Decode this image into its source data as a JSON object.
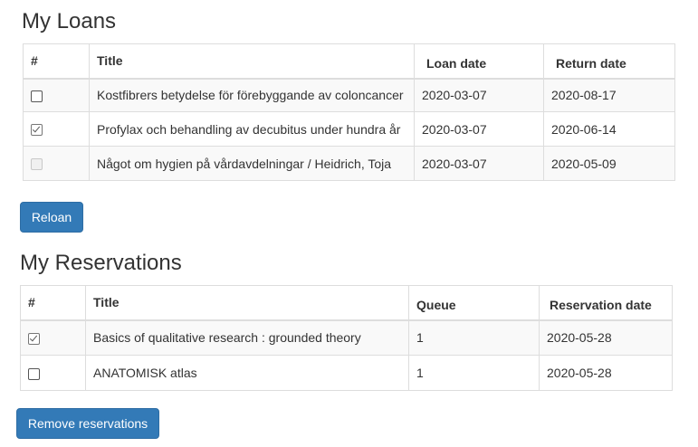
{
  "loans": {
    "heading": "My Loans",
    "columns": {
      "num": "#",
      "title": "Title",
      "loan_date": "Loan date",
      "return_date": "Return date"
    },
    "rows": [
      {
        "title": "Kostfibrers betydelse för förebyggande av coloncancer",
        "loan_date": "2020-03-07",
        "return_date": "2020-08-17",
        "checkbox": "unchecked"
      },
      {
        "title": "Profylax och behandling av decubitus under hundra år",
        "loan_date": "2020-03-07",
        "return_date": "2020-06-14",
        "checkbox": "checked"
      },
      {
        "title": "Något om hygien på vårdavdelningar / Heidrich, Toja",
        "loan_date": "2020-03-07",
        "return_date": "2020-05-09",
        "checkbox": "disabled"
      }
    ],
    "reload_button": "Reloan"
  },
  "reservations": {
    "heading": "My Reservations",
    "columns": {
      "num": "#",
      "title": "Title",
      "queue": "Queue",
      "reservation_date": "Reservation date"
    },
    "rows": [
      {
        "title": "Basics of qualitative research : grounded theory",
        "queue": "1",
        "reservation_date": "2020-05-28",
        "checkbox": "checked"
      },
      {
        "title": "ANATOMISK atlas",
        "queue": "1",
        "reservation_date": "2020-05-28",
        "checkbox": "unchecked"
      }
    ],
    "remove_button": "Remove reservations"
  },
  "colors": {
    "primary": "#337ab7",
    "border": "#dddddd",
    "stripe": "#f9f9f9"
  }
}
